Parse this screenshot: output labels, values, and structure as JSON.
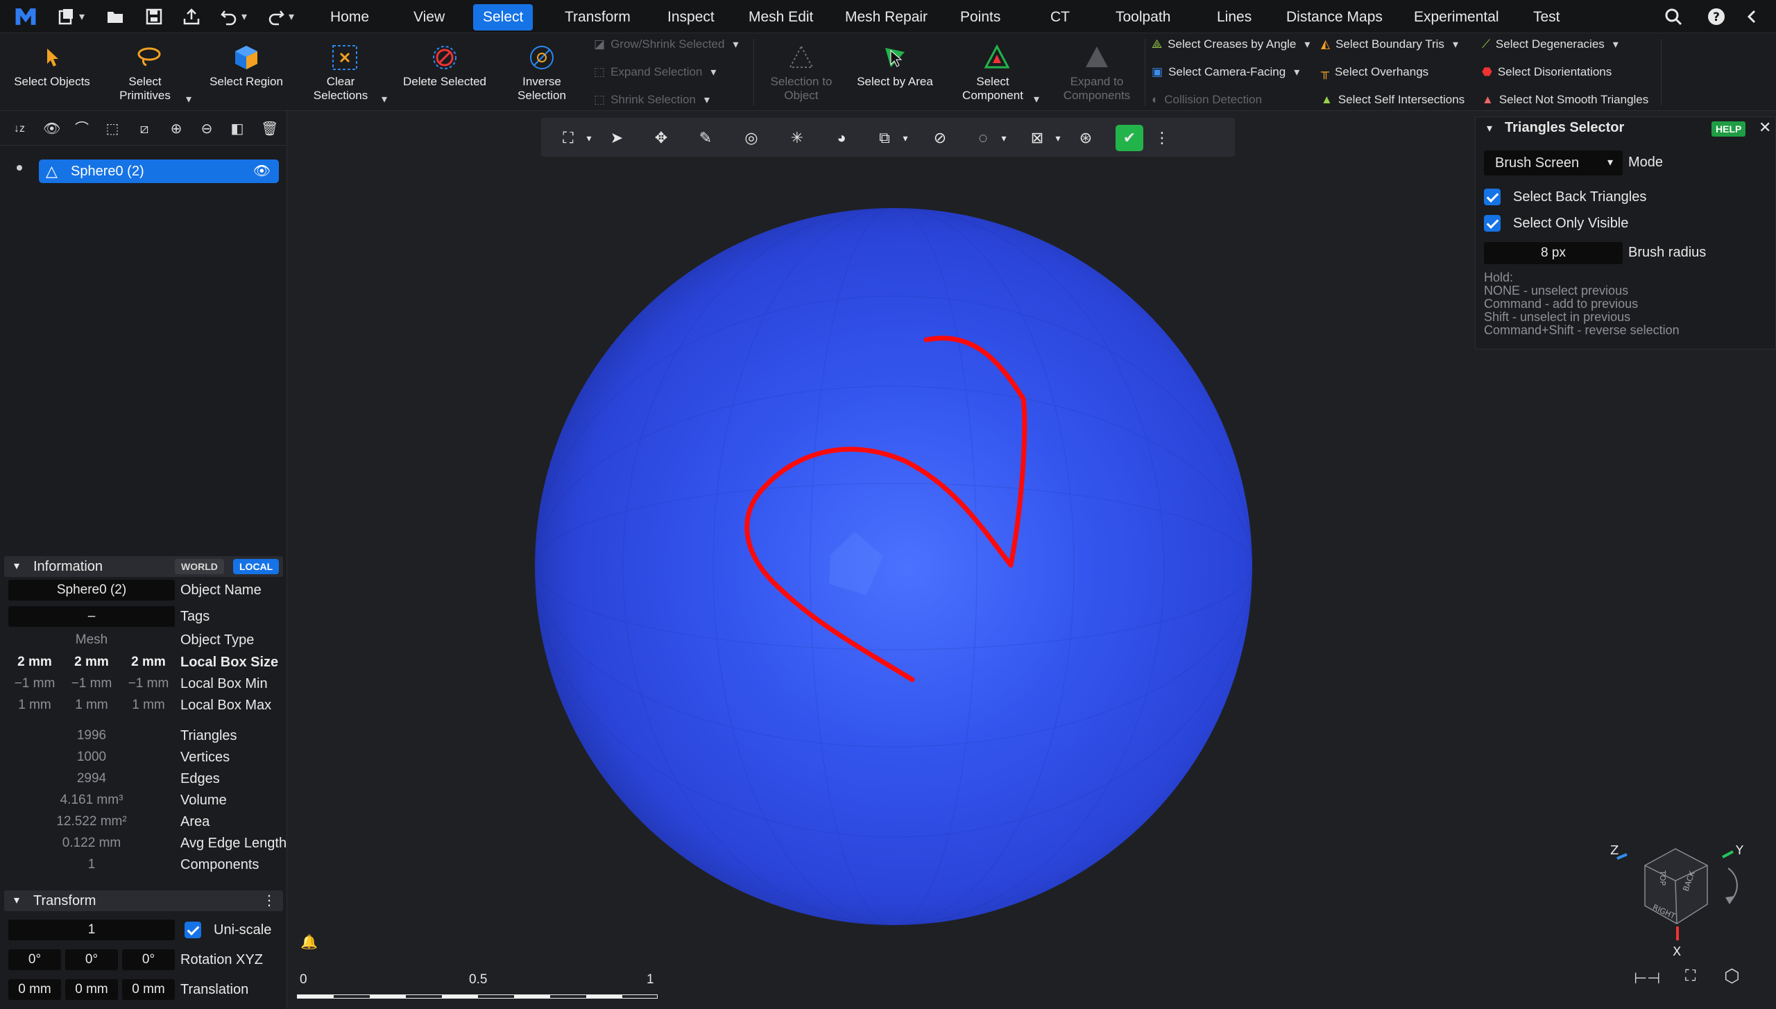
{
  "topbar": {
    "tabs": [
      "Home",
      "View",
      "Select",
      "Transform",
      "Inspect",
      "Mesh Edit",
      "Mesh Repair",
      "Points",
      "CT",
      "Toolpath",
      "Lines",
      "Distance Maps",
      "Experimental",
      "Test"
    ],
    "active_tab": "Select"
  },
  "ribbon": {
    "select_objects": "Select Objects",
    "select_primitives": "Select Primitives",
    "select_region": "Select Region",
    "clear_selections": "Clear Selections",
    "delete_selected": "Delete Selected",
    "inverse_selection": "Inverse Selection",
    "grow_shrink": "Grow/Shrink Selected",
    "expand_selection": "Expand Selection",
    "shrink_selection": "Shrink Selection",
    "selection_to_object": "Selection to Object",
    "select_by_area": "Select by Area",
    "select_component": "Select Component",
    "expand_to_components": "Expand to Components",
    "select_creases": "Select Creases by Angle",
    "select_camera_facing": "Select Camera-Facing",
    "collision_detection": "Collision Detection",
    "select_boundary_tris": "Select Boundary Tris",
    "select_overhangs": "Select Overhangs",
    "select_self_intersections": "Select Self Intersections",
    "select_degeneracies": "Select Degeneracies",
    "select_disorientations": "Select Disorientations",
    "select_not_smooth": "Select Not Smooth Triangles"
  },
  "scene_tree": {
    "item": "Sphere0 (2)"
  },
  "information": {
    "header": "Information",
    "world": "WORLD",
    "local": "LOCAL",
    "object_name_value": "Sphere0 (2)",
    "object_name_label": "Object Name",
    "tags_value": "–",
    "tags_label": "Tags",
    "type_value": "Mesh",
    "type_label": "Object Type",
    "box_size": [
      "2 mm",
      "2 mm",
      "2 mm"
    ],
    "box_size_label": "Local Box Size",
    "box_min": [
      "−1 mm",
      "−1 mm",
      "−1 mm"
    ],
    "box_min_label": "Local Box Min",
    "box_max": [
      "1 mm",
      "1 mm",
      "1 mm"
    ],
    "box_max_label": "Local Box Max",
    "triangles": "1996",
    "triangles_label": "Triangles",
    "vertices": "1000",
    "vertices_label": "Vertices",
    "edges": "2994",
    "edges_label": "Edges",
    "volume": "4.161 mm³",
    "volume_label": "Volume",
    "area": "12.522 mm²",
    "area_label": "Area",
    "avg_edge": "0.122 mm",
    "avg_edge_label": "Avg Edge Length",
    "components": "1",
    "components_label": "Components"
  },
  "transform": {
    "header": "Transform",
    "scale_value": "1",
    "uniscale_label": "Uni-scale",
    "rotation": [
      "0°",
      "0°",
      "0°"
    ],
    "rotation_label": "Rotation XYZ",
    "translation": [
      "0 mm",
      "0 mm",
      "0 mm"
    ],
    "translation_label": "Translation"
  },
  "triangles_selector": {
    "title": "Triangles Selector",
    "help": "HELP",
    "mode_value": "Brush Screen",
    "mode_label": "Mode",
    "back_triangles": "Select Back Triangles",
    "only_visible": "Select Only Visible",
    "radius_value": "8 px",
    "radius_label": "Brush radius",
    "hold_lines": [
      "Hold:",
      "NONE - unselect previous",
      "Command - add to previous",
      "Shift - unselect in previous",
      "Command+Shift - reverse selection"
    ]
  },
  "scale_bar": {
    "ticks": [
      "0",
      "0.5",
      "1"
    ]
  },
  "view_cube": {
    "axes": [
      "Z",
      "Y",
      "X"
    ],
    "faces": [
      "TOP",
      "BACK",
      "RIGHT"
    ]
  },
  "colors": {
    "accent": "#1673e6",
    "sphere": "#2f4ee0",
    "stroke": "#ff0a0a",
    "background": "#1f2023"
  }
}
